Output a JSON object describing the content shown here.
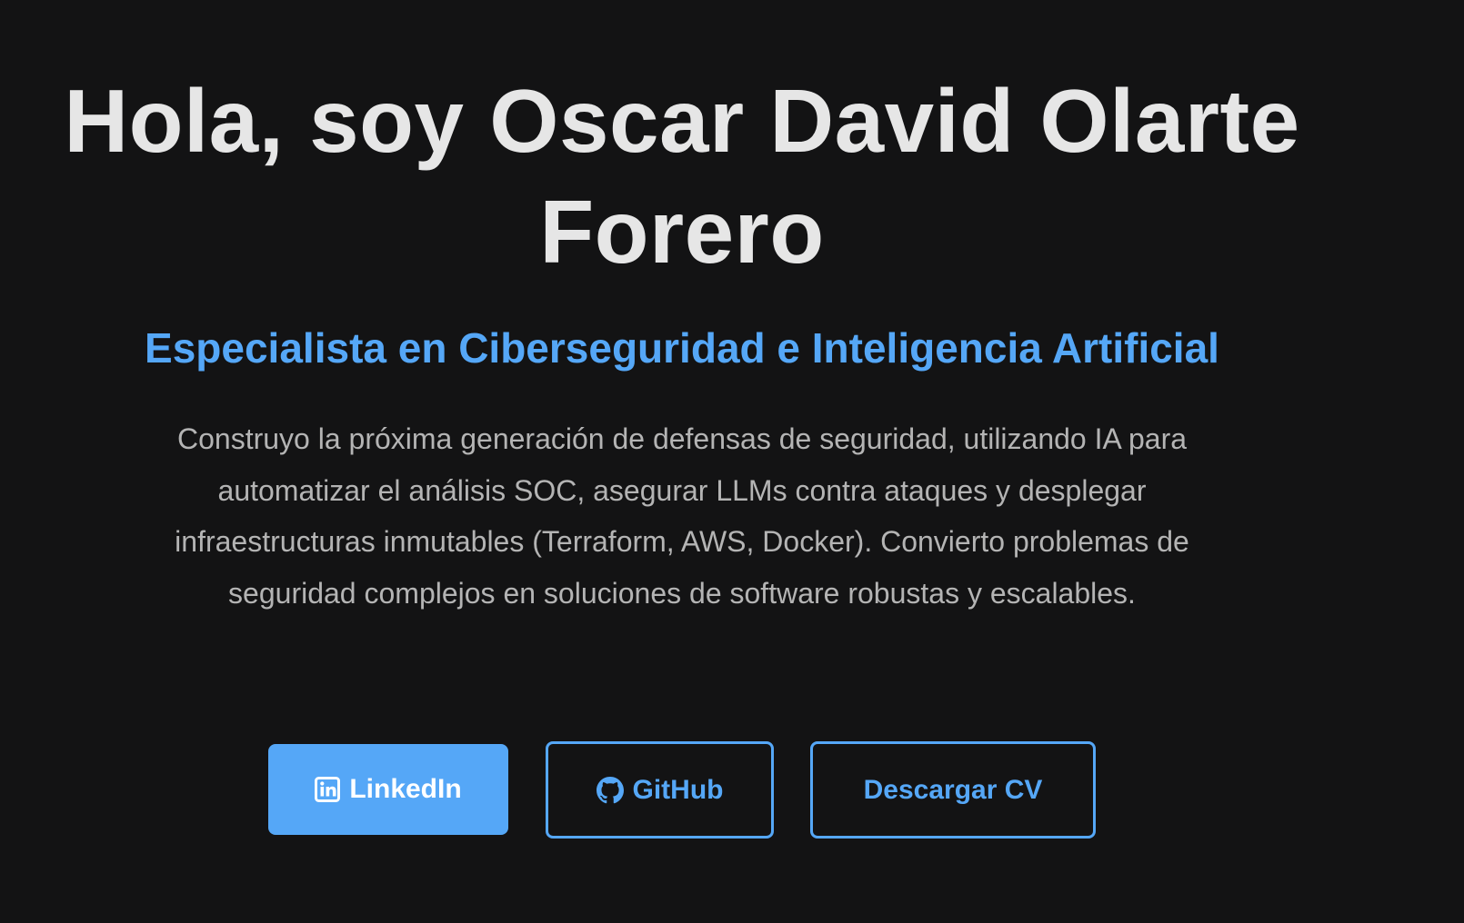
{
  "hero": {
    "title": "Hola, soy Oscar David Olarte Forero",
    "subtitle": "Especialista en Ciberseguridad e Inteligencia Artificial",
    "description": "Construyo la próxima generación de defensas de seguridad, utilizando IA para automatizar el análisis SOC, asegurar LLMs contra ataques y desplegar infraestructuras inmutables (Terraform, AWS, Docker). Convierto problemas de seguridad complejos en soluciones de software robustas y escalables."
  },
  "buttons": {
    "linkedin": {
      "label": "LinkedIn",
      "icon": "linkedin-icon"
    },
    "github": {
      "label": "GitHub",
      "icon": "github-icon"
    },
    "cv": {
      "label": "Descargar CV"
    }
  },
  "colors": {
    "background": "#131314",
    "title": "#e6e6e6",
    "accent": "#55a7f7",
    "body_text": "#b4b4b4"
  }
}
